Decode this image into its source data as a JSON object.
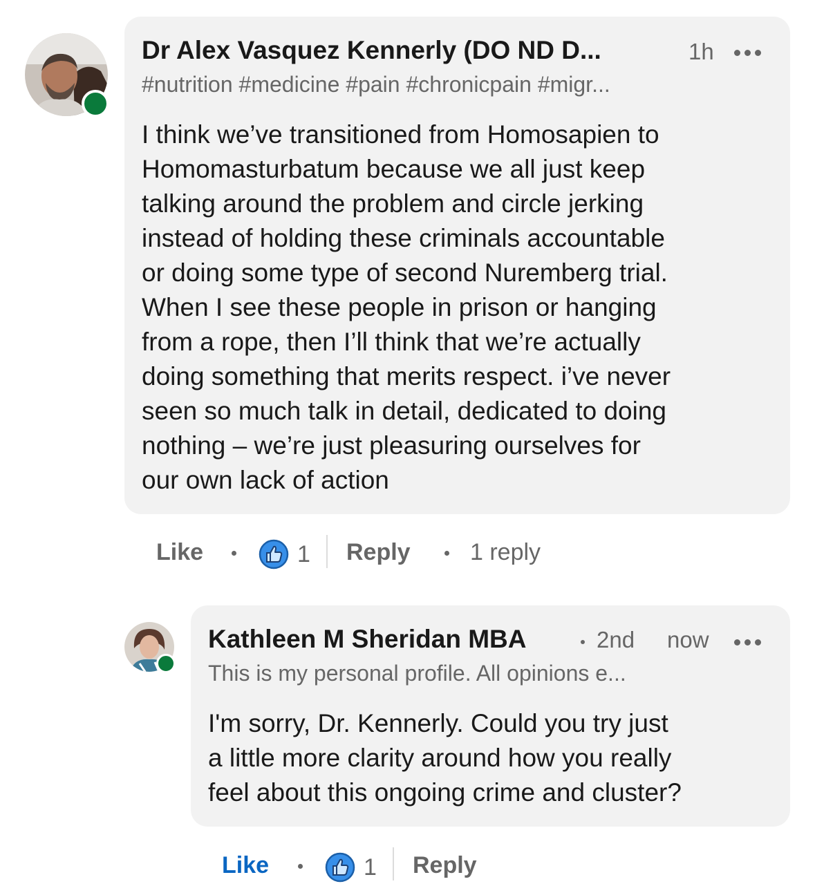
{
  "colors": {
    "bubble": "#f2f2f2",
    "presence": "#0a7a3b",
    "like_active": "#0a66c2",
    "muted": "#666666"
  },
  "comment": {
    "author": "Dr Alex Vasquez Kennerly (DO ND D...",
    "time": "1h",
    "headline": "#nutrition #medicine #pain #chronicpain #migr...",
    "text": "I think we’ve transitioned from Homosapien to\nHomomasturbatum because we all just keep\ntalking around the problem and circle jerking\ninstead of holding these criminals accountable\nor doing some type of second Nuremberg trial.\nWhen I see these people in prison or hanging\nfrom a rope, then I’ll think that we’re actually\ndoing something that merits respect. i’ve never\nseen so much talk in detail, dedicated to doing\nnothing – we’re just pleasuring ourselves for\nour own lack of action",
    "like_label": "Like",
    "reaction_count": "1",
    "reply_label": "Reply",
    "replies_label": "1 reply",
    "reaction_icon": "thumbs-up-icon",
    "more_icon": "more-options-icon"
  },
  "reply": {
    "author": "Kathleen M Sheridan MBA",
    "degree": "2nd",
    "time": "now",
    "headline": "This is my personal profile. All opinions e...",
    "text": "I'm sorry, Dr. Kennerly. Could you try just\na little more clarity around how you really\nfeel about this ongoing crime and cluster?",
    "like_label": "Like",
    "reaction_count": "1",
    "reply_label": "Reply",
    "reaction_icon": "thumbs-up-icon",
    "more_icon": "more-options-icon"
  }
}
